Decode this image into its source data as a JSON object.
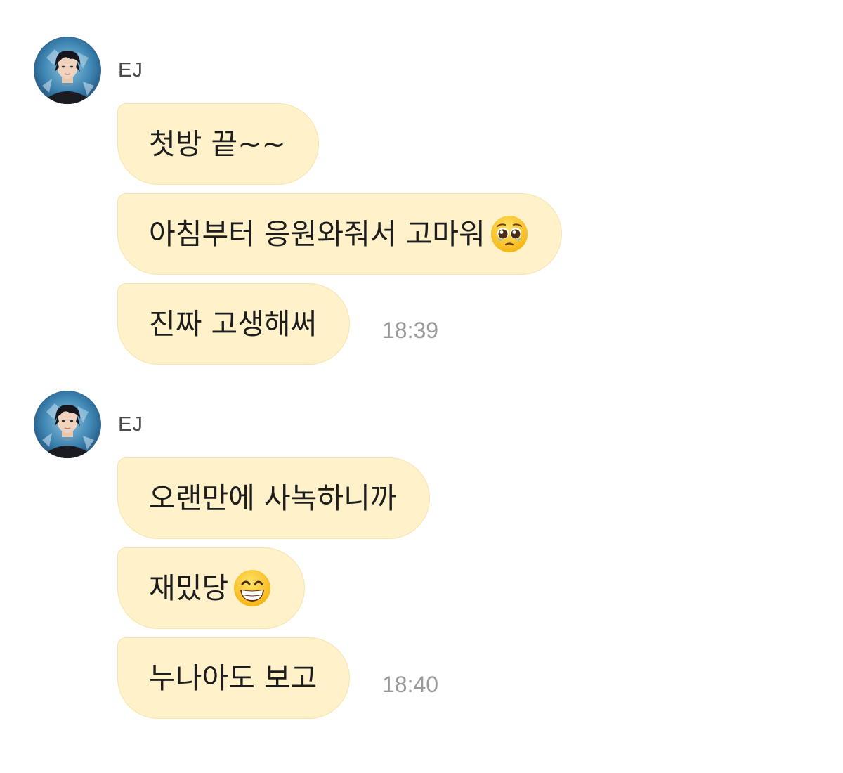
{
  "chat": {
    "groups": [
      {
        "sender": "EJ",
        "messages": [
          {
            "text": "첫방 끝~~",
            "emoji": ""
          },
          {
            "text": "아침부터 응원와줘서 고마워",
            "emoji": "pleading-face"
          },
          {
            "text": "진짜 고생해써",
            "emoji": ""
          }
        ],
        "time": "18:39"
      },
      {
        "sender": "EJ",
        "messages": [
          {
            "text": "오랜만에 사녹하니까",
            "emoji": ""
          },
          {
            "text": "재밌당",
            "emoji": "grinning-face"
          },
          {
            "text": "누나아도 보고",
            "emoji": ""
          }
        ],
        "time": "18:40"
      }
    ]
  },
  "colors": {
    "bubble": "#fff1c9",
    "bubble_border": "#f6e3ae",
    "text": "#1d1d1d",
    "time": "#9a9a9a",
    "sender": "#4a4a4a"
  }
}
